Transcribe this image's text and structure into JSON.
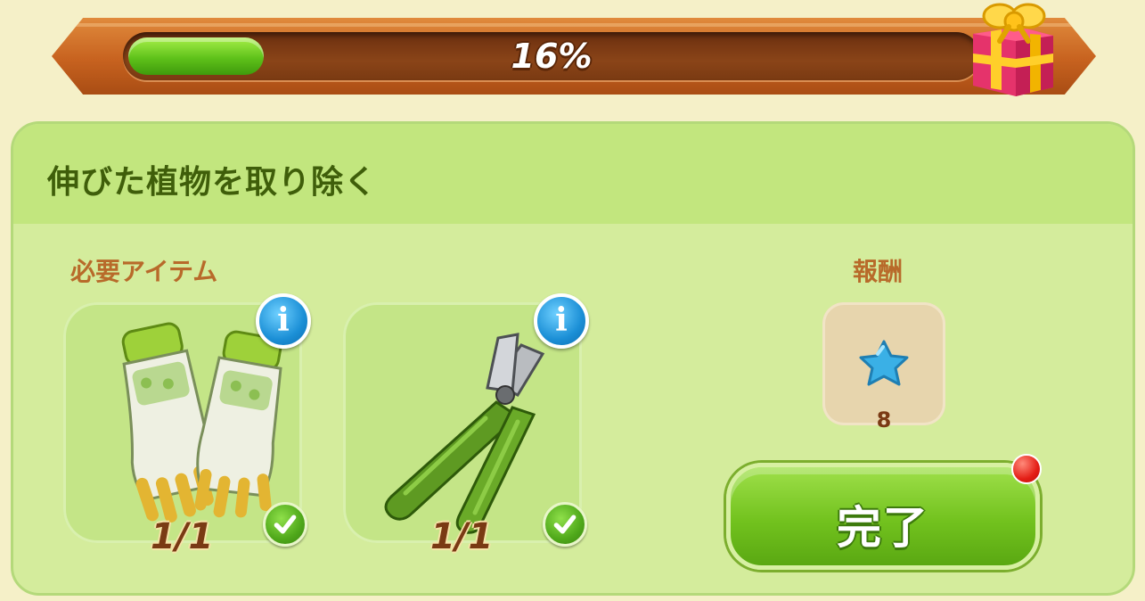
{
  "progress": {
    "value": 0.16,
    "label": "16%",
    "fill_color": "#6ccb1f",
    "reward_icon": "gift-box-icon"
  },
  "task": {
    "title": "伸びた植物を取り除く"
  },
  "required_items": {
    "label": "必要アイテム",
    "items": [
      {
        "icon": "gardening-gloves-icon",
        "count": "1/1",
        "complete": true
      },
      {
        "icon": "pruning-shears-icon",
        "count": "1/1",
        "complete": true
      }
    ]
  },
  "reward": {
    "label": "報酬",
    "icon": "blue-star-icon",
    "amount": "8"
  },
  "complete_button": {
    "label": "完了",
    "has_notification": true
  },
  "colors": {
    "panel": "#d4ec9c",
    "header": "#c2e67e",
    "title_text": "#3f5e0a",
    "section_label": "#b86a2a",
    "button_green": "#72c21e",
    "info_blue": "#1b8fd6",
    "notification_red": "#e41e16"
  }
}
